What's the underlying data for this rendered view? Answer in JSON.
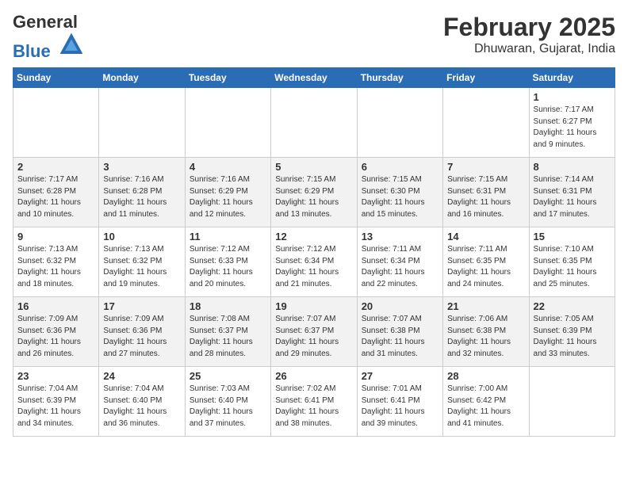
{
  "header": {
    "logo_line1": "General",
    "logo_line2": "Blue",
    "month_title": "February 2025",
    "location": "Dhuwaran, Gujarat, India"
  },
  "days_of_week": [
    "Sunday",
    "Monday",
    "Tuesday",
    "Wednesday",
    "Thursday",
    "Friday",
    "Saturday"
  ],
  "weeks": [
    [
      {
        "day": "",
        "info": ""
      },
      {
        "day": "",
        "info": ""
      },
      {
        "day": "",
        "info": ""
      },
      {
        "day": "",
        "info": ""
      },
      {
        "day": "",
        "info": ""
      },
      {
        "day": "",
        "info": ""
      },
      {
        "day": "1",
        "info": "Sunrise: 7:17 AM\nSunset: 6:27 PM\nDaylight: 11 hours\nand 9 minutes."
      }
    ],
    [
      {
        "day": "2",
        "info": "Sunrise: 7:17 AM\nSunset: 6:28 PM\nDaylight: 11 hours\nand 10 minutes."
      },
      {
        "day": "3",
        "info": "Sunrise: 7:16 AM\nSunset: 6:28 PM\nDaylight: 11 hours\nand 11 minutes."
      },
      {
        "day": "4",
        "info": "Sunrise: 7:16 AM\nSunset: 6:29 PM\nDaylight: 11 hours\nand 12 minutes."
      },
      {
        "day": "5",
        "info": "Sunrise: 7:15 AM\nSunset: 6:29 PM\nDaylight: 11 hours\nand 13 minutes."
      },
      {
        "day": "6",
        "info": "Sunrise: 7:15 AM\nSunset: 6:30 PM\nDaylight: 11 hours\nand 15 minutes."
      },
      {
        "day": "7",
        "info": "Sunrise: 7:15 AM\nSunset: 6:31 PM\nDaylight: 11 hours\nand 16 minutes."
      },
      {
        "day": "8",
        "info": "Sunrise: 7:14 AM\nSunset: 6:31 PM\nDaylight: 11 hours\nand 17 minutes."
      }
    ],
    [
      {
        "day": "9",
        "info": "Sunrise: 7:13 AM\nSunset: 6:32 PM\nDaylight: 11 hours\nand 18 minutes."
      },
      {
        "day": "10",
        "info": "Sunrise: 7:13 AM\nSunset: 6:32 PM\nDaylight: 11 hours\nand 19 minutes."
      },
      {
        "day": "11",
        "info": "Sunrise: 7:12 AM\nSunset: 6:33 PM\nDaylight: 11 hours\nand 20 minutes."
      },
      {
        "day": "12",
        "info": "Sunrise: 7:12 AM\nSunset: 6:34 PM\nDaylight: 11 hours\nand 21 minutes."
      },
      {
        "day": "13",
        "info": "Sunrise: 7:11 AM\nSunset: 6:34 PM\nDaylight: 11 hours\nand 22 minutes."
      },
      {
        "day": "14",
        "info": "Sunrise: 7:11 AM\nSunset: 6:35 PM\nDaylight: 11 hours\nand 24 minutes."
      },
      {
        "day": "15",
        "info": "Sunrise: 7:10 AM\nSunset: 6:35 PM\nDaylight: 11 hours\nand 25 minutes."
      }
    ],
    [
      {
        "day": "16",
        "info": "Sunrise: 7:09 AM\nSunset: 6:36 PM\nDaylight: 11 hours\nand 26 minutes."
      },
      {
        "day": "17",
        "info": "Sunrise: 7:09 AM\nSunset: 6:36 PM\nDaylight: 11 hours\nand 27 minutes."
      },
      {
        "day": "18",
        "info": "Sunrise: 7:08 AM\nSunset: 6:37 PM\nDaylight: 11 hours\nand 28 minutes."
      },
      {
        "day": "19",
        "info": "Sunrise: 7:07 AM\nSunset: 6:37 PM\nDaylight: 11 hours\nand 29 minutes."
      },
      {
        "day": "20",
        "info": "Sunrise: 7:07 AM\nSunset: 6:38 PM\nDaylight: 11 hours\nand 31 minutes."
      },
      {
        "day": "21",
        "info": "Sunrise: 7:06 AM\nSunset: 6:38 PM\nDaylight: 11 hours\nand 32 minutes."
      },
      {
        "day": "22",
        "info": "Sunrise: 7:05 AM\nSunset: 6:39 PM\nDaylight: 11 hours\nand 33 minutes."
      }
    ],
    [
      {
        "day": "23",
        "info": "Sunrise: 7:04 AM\nSunset: 6:39 PM\nDaylight: 11 hours\nand 34 minutes."
      },
      {
        "day": "24",
        "info": "Sunrise: 7:04 AM\nSunset: 6:40 PM\nDaylight: 11 hours\nand 36 minutes."
      },
      {
        "day": "25",
        "info": "Sunrise: 7:03 AM\nSunset: 6:40 PM\nDaylight: 11 hours\nand 37 minutes."
      },
      {
        "day": "26",
        "info": "Sunrise: 7:02 AM\nSunset: 6:41 PM\nDaylight: 11 hours\nand 38 minutes."
      },
      {
        "day": "27",
        "info": "Sunrise: 7:01 AM\nSunset: 6:41 PM\nDaylight: 11 hours\nand 39 minutes."
      },
      {
        "day": "28",
        "info": "Sunrise: 7:00 AM\nSunset: 6:42 PM\nDaylight: 11 hours\nand 41 minutes."
      },
      {
        "day": "",
        "info": ""
      }
    ]
  ]
}
